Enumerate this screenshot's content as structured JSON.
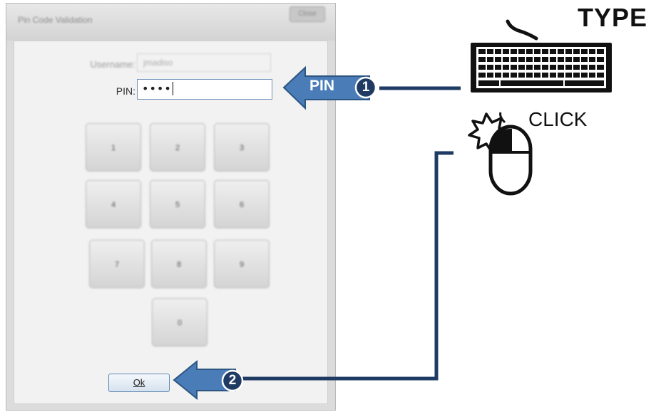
{
  "window": {
    "title": "Pin Code Validation",
    "close_label": "Close"
  },
  "form": {
    "username_label": "Username:",
    "username_value": "jmadiso",
    "pin_label": "PIN:",
    "pin_value": "••••"
  },
  "keypad": {
    "keys": [
      "1",
      "2",
      "3",
      "4",
      "5",
      "6",
      "7",
      "8",
      "9",
      "0"
    ]
  },
  "ok_button": {
    "label": "Ok"
  },
  "annotations": {
    "type_label": "TYPE",
    "click_label": "CLICK",
    "pin_arrow_label": "PIN",
    "step1": "1",
    "step2": "2",
    "arrow_color": "#4a7db8",
    "line_color": "#1f3b64"
  }
}
